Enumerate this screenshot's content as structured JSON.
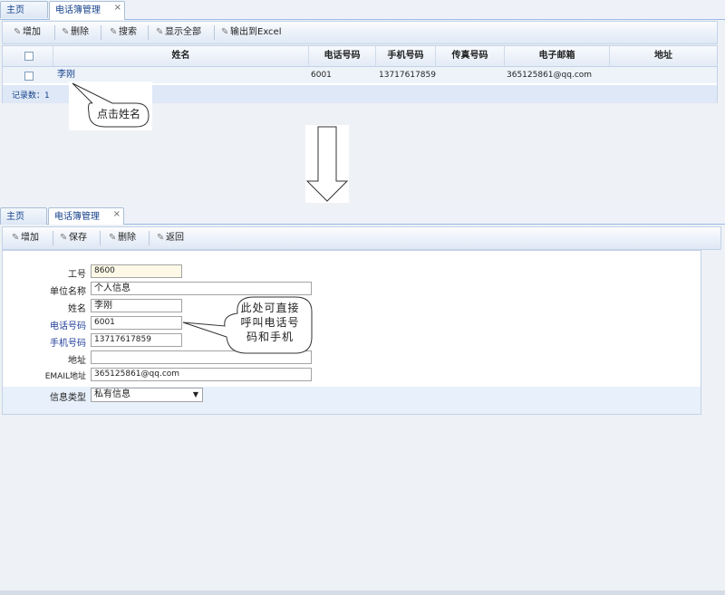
{
  "top": {
    "tabs": {
      "home": "主页",
      "phonebook": "电话簿管理"
    },
    "close_glyph": "×",
    "toolbar": {
      "add": "增加",
      "delete": "删除",
      "search": "搜索",
      "show_all": "显示全部",
      "export": "输出到Excel"
    },
    "grid": {
      "columns": {
        "name": "姓名",
        "phone": "电话号码",
        "mobile": "手机号码",
        "fax": "传真号码",
        "email": "电子邮箱",
        "address": "地址"
      },
      "row": {
        "name": "李刚",
        "phone": "6001",
        "mobile": "13717617859",
        "fax": "",
        "email": "365125861@qq.com",
        "address": ""
      },
      "record_count": "记录数：1"
    },
    "callout": "点击姓名"
  },
  "bottom": {
    "tabs": {
      "home": "主页",
      "phonebook": "电话簿管理"
    },
    "close_glyph": "×",
    "toolbar": {
      "add": "增加",
      "save": "保存",
      "delete": "删除",
      "back": "返回"
    },
    "form": {
      "labels": {
        "emp_id": "工号",
        "unit": "单位名称",
        "name": "姓名",
        "phone": "电话号码",
        "mobile": "手机号码",
        "address": "地址",
        "email": "EMAIL地址",
        "info_type": "信息类型"
      },
      "values": {
        "emp_id": "8600",
        "unit": "个人信息",
        "name": "李刚",
        "phone": "6001",
        "mobile": "13717617859",
        "address": "",
        "email": "365125861@qq.com",
        "info_type": "私有信息"
      }
    },
    "callout": {
      "line1": "此处可直接",
      "line2": "呼叫电话号",
      "line3": "码和手机"
    }
  },
  "icons": {
    "tool": "pencil-icon",
    "arrow": "down-arrow-icon",
    "select": "dropdown-arrow-icon"
  },
  "colors": {
    "link": "#15428b",
    "highlight_field": "#fdf9e6",
    "label_blue": "#1f3d9a"
  }
}
